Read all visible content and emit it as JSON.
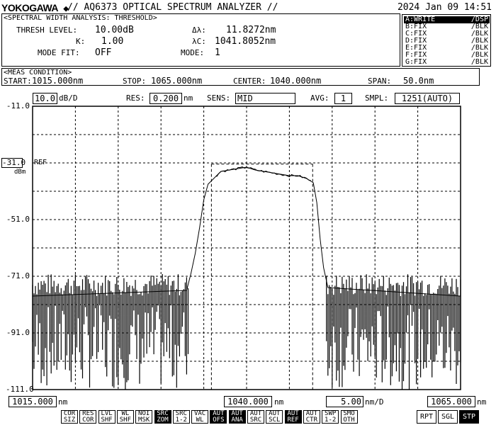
{
  "header": {
    "brand": "YOKOGAWA",
    "title": "// AQ6373 OPTICAL SPECTRUM ANALYZER //",
    "datetime": "2024 Jan 09 14:51"
  },
  "analysis": {
    "heading": "<SPECTRAL WIDTH ANALYSIS: THRESHOLD>",
    "thresh_label": "THRESH LEVEL:",
    "thresh_value": "10.00dB",
    "k_label": "K:",
    "k_value": "1.00",
    "modefit_label": "MODE FIT:",
    "modefit_value": "OFF",
    "dlambda_label": "Δλ:",
    "dlambda_value": "11.8272nm",
    "lambdac_label": "λC:",
    "lambdac_value": "1041.8052nm",
    "mode_label": "MODE:",
    "mode_value": "1"
  },
  "traces": [
    {
      "name": "A:WRITE",
      "mode": "/DSP",
      "active": true
    },
    {
      "name": "B:FIX",
      "mode": "/BLK",
      "active": false
    },
    {
      "name": "C:FIX",
      "mode": "/BLK",
      "active": false
    },
    {
      "name": "D:FIX",
      "mode": "/BLK",
      "active": false
    },
    {
      "name": "E:FIX",
      "mode": "/BLK",
      "active": false
    },
    {
      "name": "F:FIX",
      "mode": "/BLK",
      "active": false
    },
    {
      "name": "G:FIX",
      "mode": "/BLK",
      "active": false
    }
  ],
  "meas": {
    "heading": "<MEAS CONDITION>",
    "start_label": "START:",
    "start_value": "1015.000nm",
    "stop_label": "STOP:",
    "stop_value": "1065.000nm",
    "center_label": "CENTER:",
    "center_value": "1040.000nm",
    "span_label": "SPAN:",
    "span_value": "50.0nm"
  },
  "settings": {
    "scale_value": "10.0",
    "scale_unit": "dB/D",
    "res_label": "RES:",
    "res_value": "0.200",
    "res_unit": "nm",
    "sens_label": "SENS:",
    "sens_value": "MID",
    "avg_label": "AVG:",
    "avg_value": "1",
    "smpl_label": "SMPL:",
    "smpl_value": "1251(AUTO)"
  },
  "chart_data": {
    "type": "line",
    "xlim": [
      1015.0,
      1065.0
    ],
    "ylim": [
      -111.0,
      -11.0
    ],
    "y_ticks": [
      "-11.0",
      "-31.0",
      "-51.0",
      "-71.0",
      "-91.0",
      "-111.0"
    ],
    "ref_level": "-31.0",
    "ref_label": "REF",
    "y_unit": "dBm",
    "grid": true,
    "threshold_markers": {
      "lower": 1035.8916,
      "upper": 1047.7188,
      "level": -31.4
    },
    "series": [
      {
        "x": [
          1015.0,
          1033.0,
          1033.5,
          1034.0,
          1034.5,
          1035.0,
          1035.5,
          1036.0,
          1036.5,
          1037.0,
          1038.0,
          1039.0,
          1040.0,
          1041.0,
          1042.0,
          1043.0,
          1044.0,
          1045.0,
          1046.0,
          1047.0,
          1047.8,
          1048.2,
          1048.6,
          1049.0,
          1049.5,
          1065.0
        ],
        "y": [
          -78,
          -76,
          -70,
          -63,
          -54,
          -44,
          -38.5,
          -37.0,
          -35.5,
          -34.0,
          -33.5,
          -33.0,
          -32.5,
          -33.5,
          -34.0,
          -34.5,
          -35.0,
          -35.5,
          -35.5,
          -36.5,
          -38,
          -45,
          -58,
          -68,
          -75,
          -78
        ],
        "noise_floor": -72,
        "noise_bottom": -111
      }
    ]
  },
  "xaxis": {
    "start": "1015.000",
    "center": "1040.000",
    "stop": "1065.000",
    "unit": "nm",
    "div_value": "5.00",
    "div_unit": "nm/D"
  },
  "softkeys": [
    {
      "top": "COR",
      "bottom": "SIZ",
      "inv": false
    },
    {
      "top": "RES",
      "bottom": "COR",
      "inv": false
    },
    {
      "top": "LVL",
      "bottom": "SHF",
      "inv": false
    },
    {
      "top": "WL",
      "bottom": "SHF",
      "inv": false
    },
    {
      "top": "NOI",
      "bottom": "MSK",
      "inv": false
    },
    {
      "top": "SRC",
      "bottom": "ZOM",
      "inv": true
    },
    {
      "top": "SRC",
      "bottom": "1-2",
      "inv": false
    },
    {
      "top": "VAC",
      "bottom": "WL",
      "inv": false
    },
    {
      "top": "AUT",
      "bottom": "OFS",
      "inv": true
    },
    {
      "top": "AUT",
      "bottom": "ANA",
      "inv": true
    },
    {
      "top": "AUT",
      "bottom": "SRC",
      "inv": false
    },
    {
      "top": "AUT",
      "bottom": "SCL",
      "inv": false
    },
    {
      "top": "AUT",
      "bottom": "REF",
      "inv": true
    },
    {
      "top": "AUT",
      "bottom": "CTR",
      "inv": false
    },
    {
      "top": "SWP",
      "bottom": "1-2",
      "inv": false
    },
    {
      "top": "SMO",
      "bottom": "OTH",
      "inv": false
    }
  ],
  "sweep_keys": [
    {
      "label": "RPT",
      "inv": false
    },
    {
      "label": "SGL",
      "inv": false
    },
    {
      "label": "STP",
      "inv": true
    }
  ]
}
